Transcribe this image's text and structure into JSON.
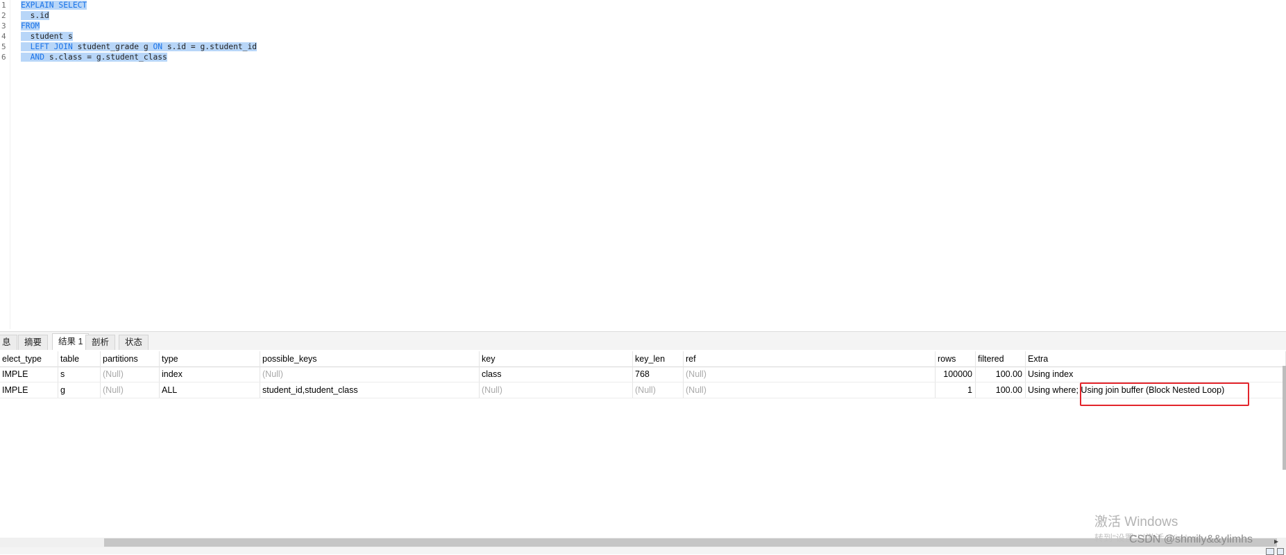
{
  "editor": {
    "line_numbers": [
      "1",
      "2",
      "3",
      "4",
      "5",
      "6"
    ],
    "lines": [
      [
        {
          "t": "EXPLAIN SELECT",
          "k": true
        }
      ],
      [
        {
          "t": "  s.id",
          "k": false
        }
      ],
      [
        {
          "t": "FROM",
          "k": true
        }
      ],
      [
        {
          "t": "  student s",
          "k": false
        }
      ],
      [
        {
          "t": "  ",
          "k": false
        },
        {
          "t": "LEFT JOIN",
          "k": true
        },
        {
          "t": " student_grade g ",
          "k": false
        },
        {
          "t": "ON",
          "k": true
        },
        {
          "t": " s.id = g.student_id",
          "k": false
        }
      ],
      [
        {
          "t": "  ",
          "k": false
        },
        {
          "t": "AND",
          "k": true
        },
        {
          "t": " s.class = g.student_class",
          "k": false
        }
      ]
    ]
  },
  "tabs": [
    "息",
    "摘要",
    "结果 1",
    "剖析",
    "状态"
  ],
  "active_tab": "结果 1",
  "grid": {
    "columns": [
      "elect_type",
      "table",
      "partitions",
      "type",
      "possible_keys",
      "key",
      "key_len",
      "ref",
      "rows",
      "filtered",
      "Extra"
    ],
    "rows": [
      [
        "IMPLE",
        "s",
        "(Null)",
        "index",
        "(Null)",
        "class",
        "768",
        "(Null)",
        "100000",
        "100.00",
        "Using index"
      ],
      [
        "IMPLE",
        "g",
        "(Null)",
        "ALL",
        "student_id,student_class",
        "(Null)",
        "(Null)",
        "(Null)",
        "1",
        "100.00",
        "Using where; Using join buffer (Block Nested Loop)"
      ]
    ]
  },
  "watermark": {
    "line1": "激活 Windows",
    "line2": "转到\"设置\"以激活 Windows。"
  },
  "csdn_mark": "CSDN @shmily&&ylimhs",
  "colors": {
    "selection": "#b8d6f8",
    "keyword": "#1a73e8",
    "highlight_box": "#e3242b"
  }
}
